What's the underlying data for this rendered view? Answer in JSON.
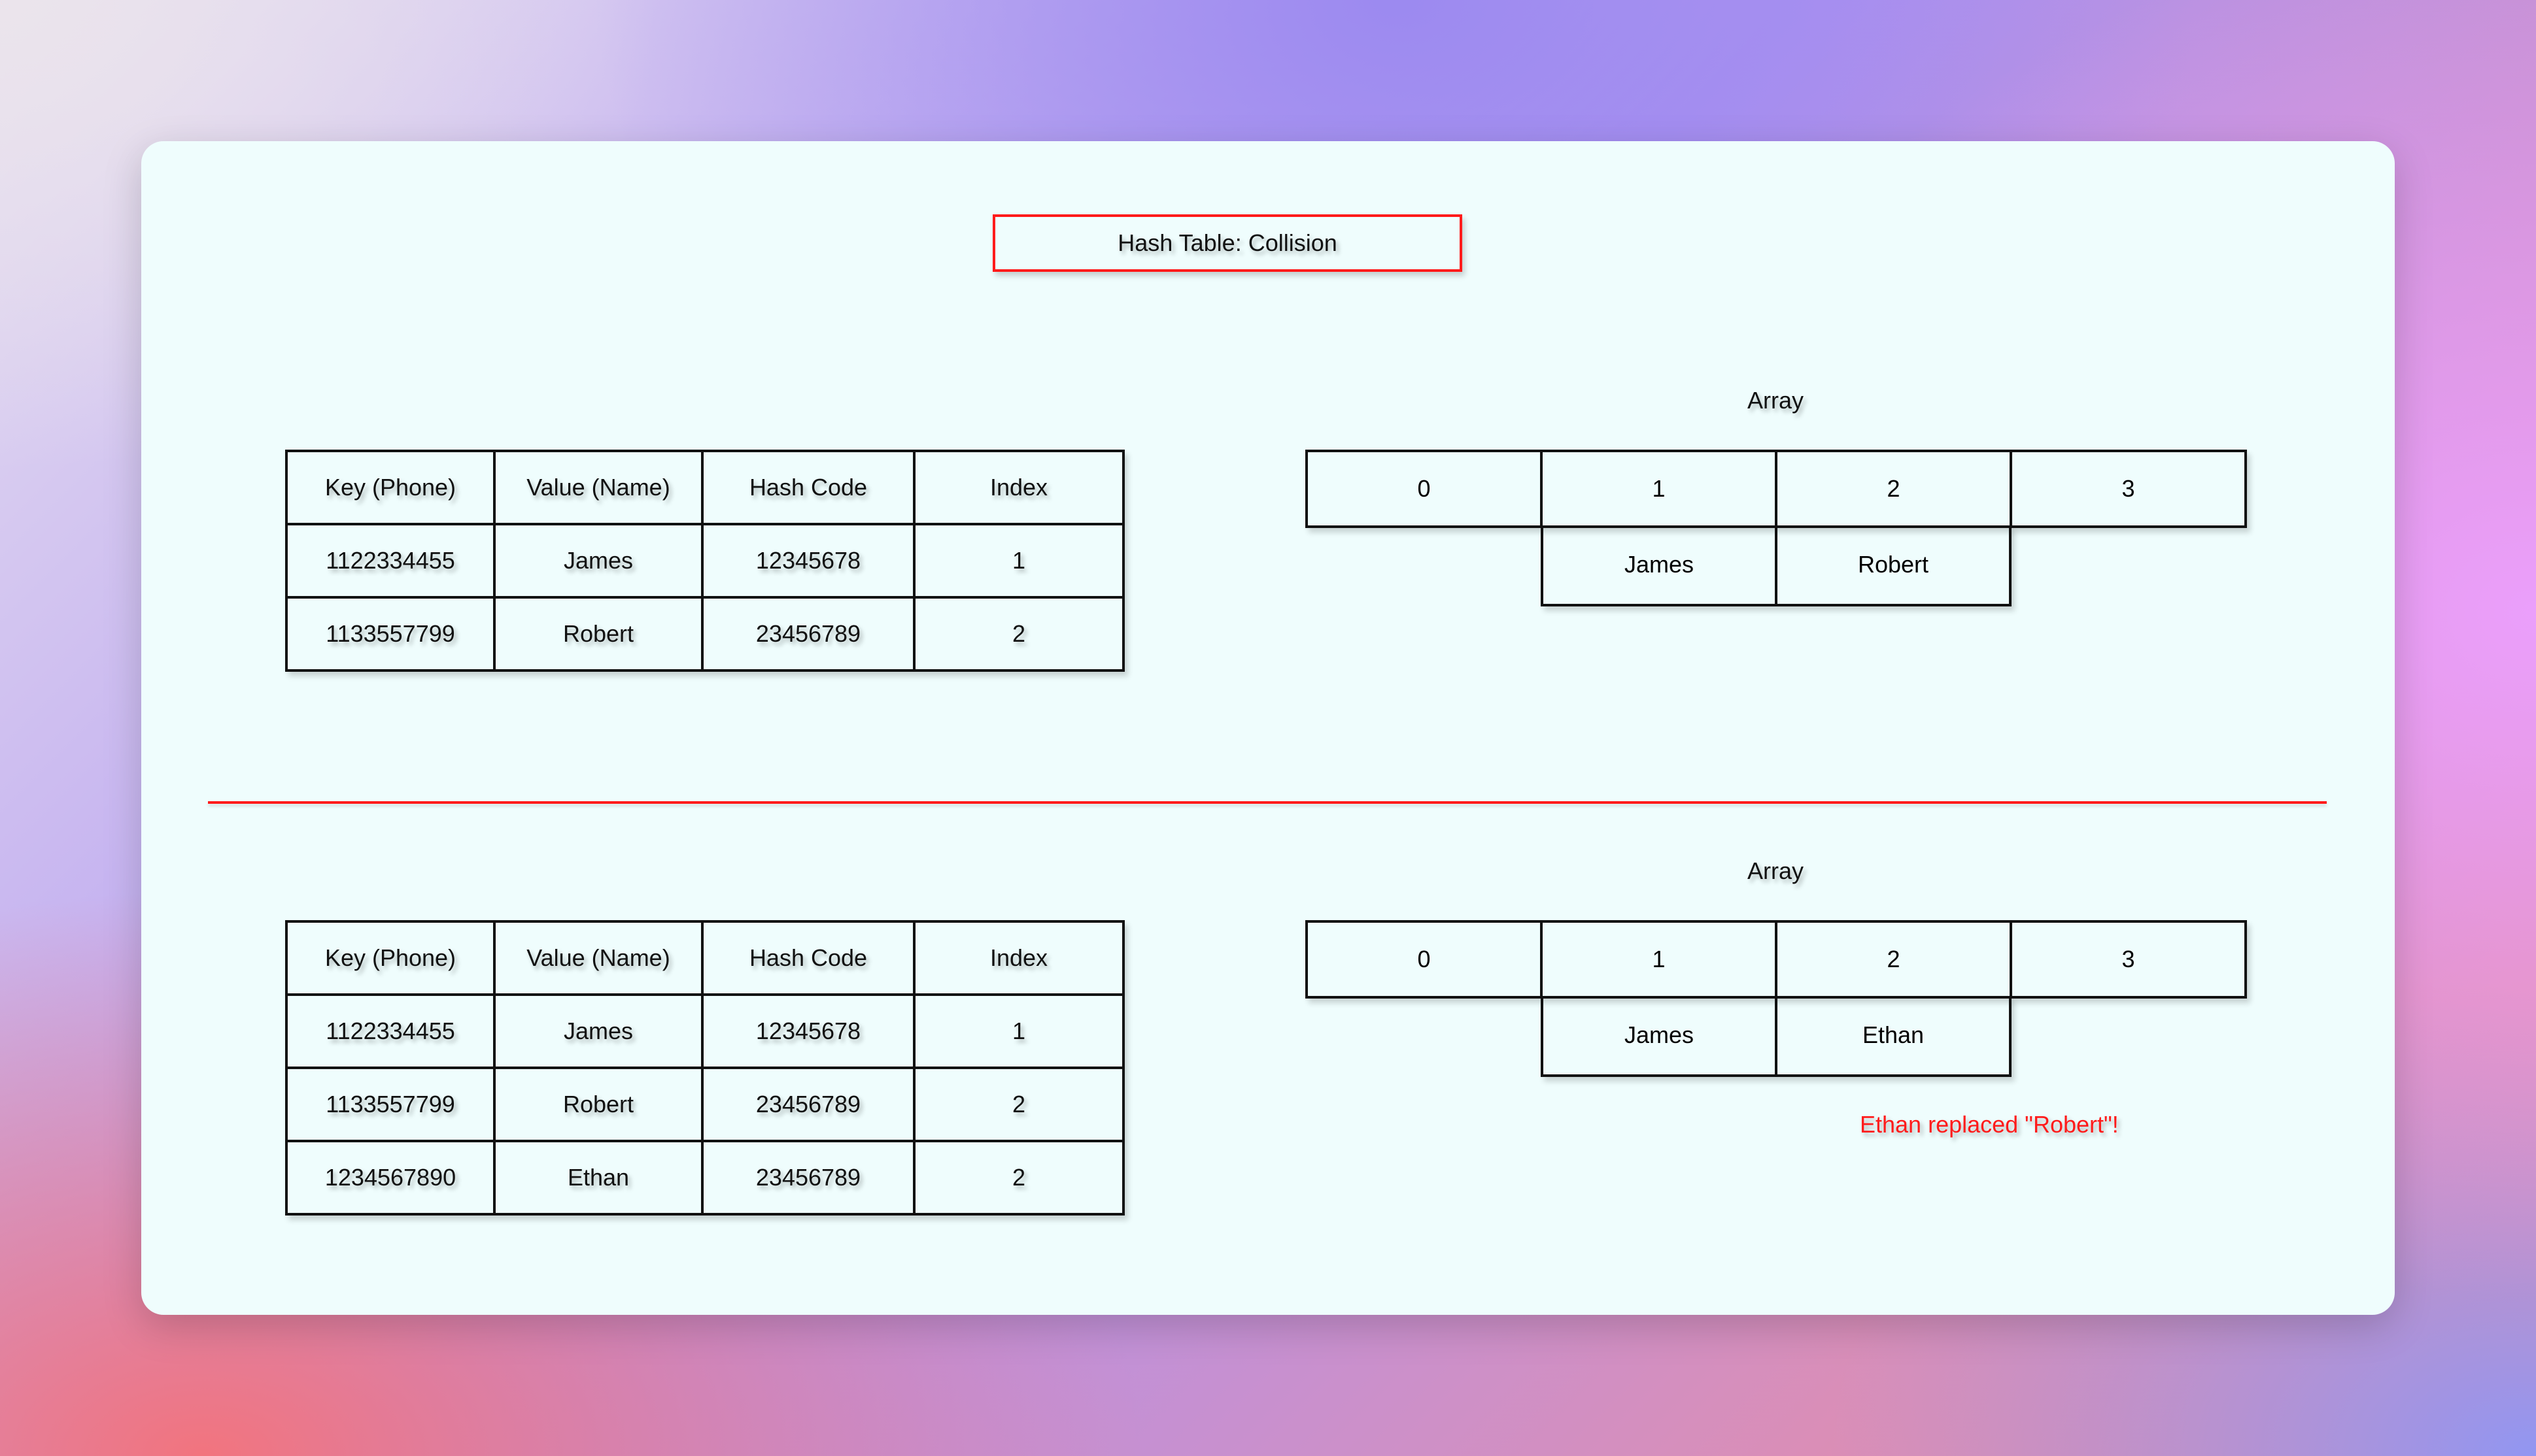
{
  "title": "Hash Table: Collision",
  "colors": {
    "accent": "#ff1b1b",
    "card_background": "#effdfd",
    "line": "#111111"
  },
  "tables": [
    {
      "headers": [
        "Key (Phone)",
        "Value (Name)",
        "Hash Code",
        "Index"
      ],
      "rows": [
        [
          "1122334455",
          "James",
          "12345678",
          "1"
        ],
        [
          "1133557799",
          "Robert",
          "23456789",
          "2"
        ]
      ]
    },
    {
      "headers": [
        "Key (Phone)",
        "Value (Name)",
        "Hash Code",
        "Index"
      ],
      "rows": [
        [
          "1122334455",
          "James",
          "12345678",
          "1"
        ],
        [
          "1133557799",
          "Robert",
          "23456789",
          "2"
        ],
        [
          "1234567890",
          "Ethan",
          "23456789",
          "2"
        ]
      ]
    }
  ],
  "arrays": [
    {
      "label": "Array",
      "indices": [
        "0",
        "1",
        "2",
        "3"
      ],
      "values": [
        "James",
        "Robert"
      ]
    },
    {
      "label": "Array",
      "indices": [
        "0",
        "1",
        "2",
        "3"
      ],
      "values": [
        "James",
        "Ethan"
      ]
    }
  ],
  "note": "Ethan replaced \"Robert\"!"
}
